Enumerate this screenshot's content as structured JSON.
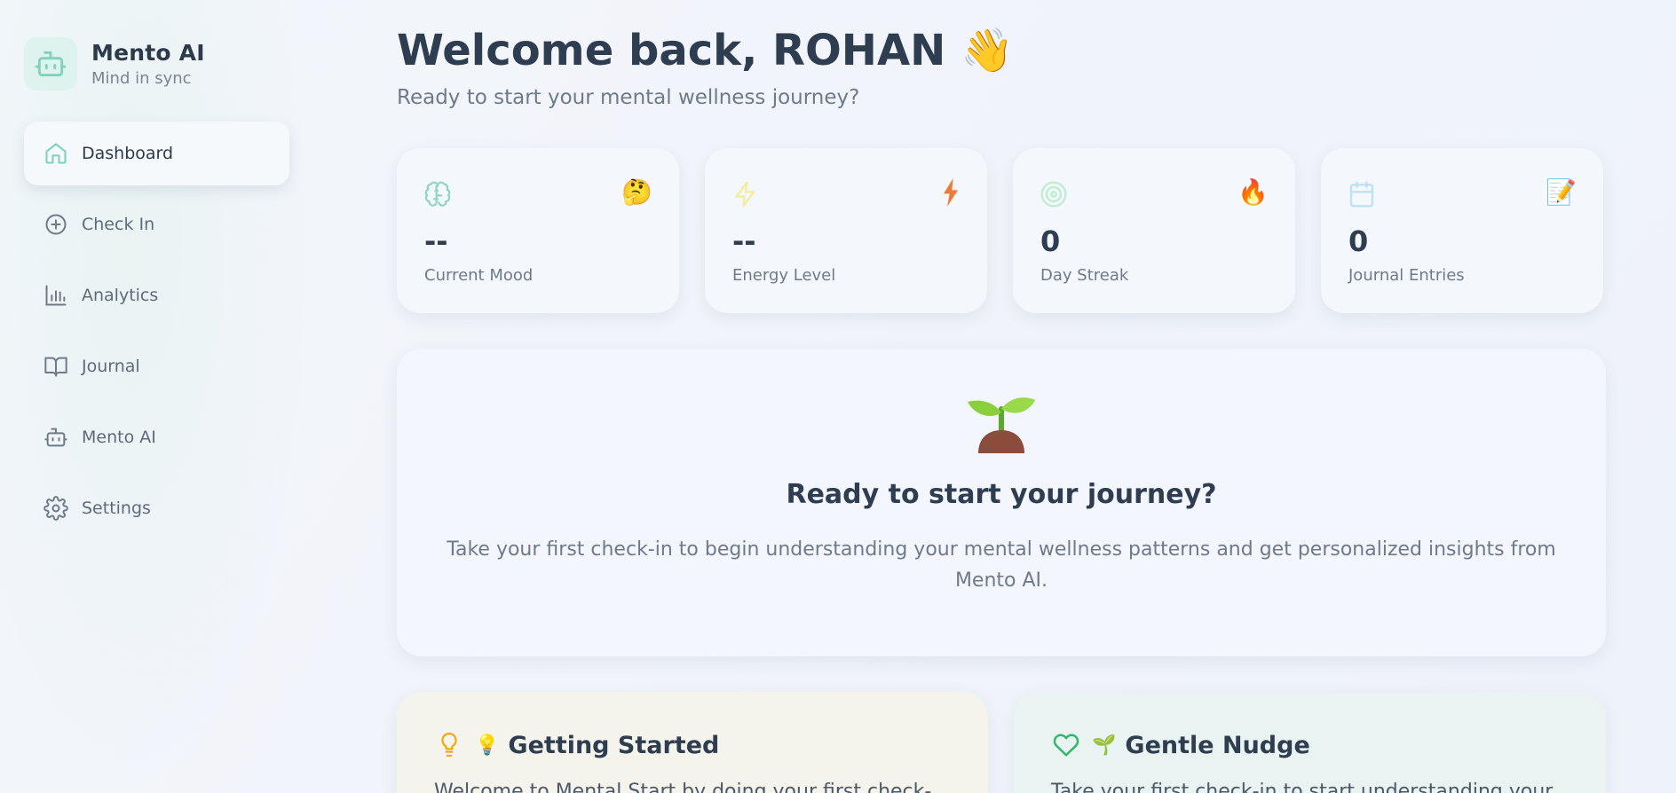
{
  "brand": {
    "name": "Mento AI",
    "tagline": "Mind in sync"
  },
  "sidebar": {
    "items": [
      {
        "label": "Dashboard",
        "icon": "home-icon",
        "active": true
      },
      {
        "label": "Check In",
        "icon": "plus-circle-icon",
        "active": false
      },
      {
        "label": "Analytics",
        "icon": "bar-chart-icon",
        "active": false
      },
      {
        "label": "Journal",
        "icon": "book-icon",
        "active": false
      },
      {
        "label": "Mento AI",
        "icon": "robot-icon",
        "active": false
      },
      {
        "label": "Settings",
        "icon": "gear-icon",
        "active": false
      }
    ]
  },
  "header": {
    "welcome": "Welcome back, ROHAN 👋",
    "subtitle": "Ready to start your mental wellness journey?"
  },
  "stats": [
    {
      "value": "--",
      "label": "Current Mood",
      "icon": "brain-icon",
      "emoji": "🤔",
      "color": "#8fd6c4"
    },
    {
      "value": "--",
      "label": "Energy Level",
      "icon": "lightning-icon",
      "emoji": "⚡",
      "color": "#f3ec9a"
    },
    {
      "value": "0",
      "label": "Day Streak",
      "icon": "target-icon",
      "emoji": "🔥",
      "color": "#bfeed0"
    },
    {
      "value": "0",
      "label": "Journal Entries",
      "icon": "calendar-icon",
      "emoji": "📝",
      "color": "#bfe1f0"
    }
  ],
  "journey": {
    "title": "Ready to start your journey?",
    "description": "Take your first check-in to begin understanding your mental wellness patterns and get personalized insights from Mento AI."
  },
  "cards": {
    "getting_started": {
      "emoji": "💡",
      "title": "Getting Started",
      "body": "Welcome to Mental Start by doing your first check-",
      "icon": "lightbulb-icon",
      "icon_color": "#f2a516"
    },
    "gentle_nudge": {
      "emoji": "🌱",
      "title": "Gentle Nudge",
      "body": "Take your first check-in to start understanding your",
      "icon": "heart-icon",
      "icon_color": "#2fb86a"
    }
  },
  "colors": {
    "accent": "#5cc9a7",
    "text": "#2f3d50",
    "muted": "#6f7a89"
  }
}
